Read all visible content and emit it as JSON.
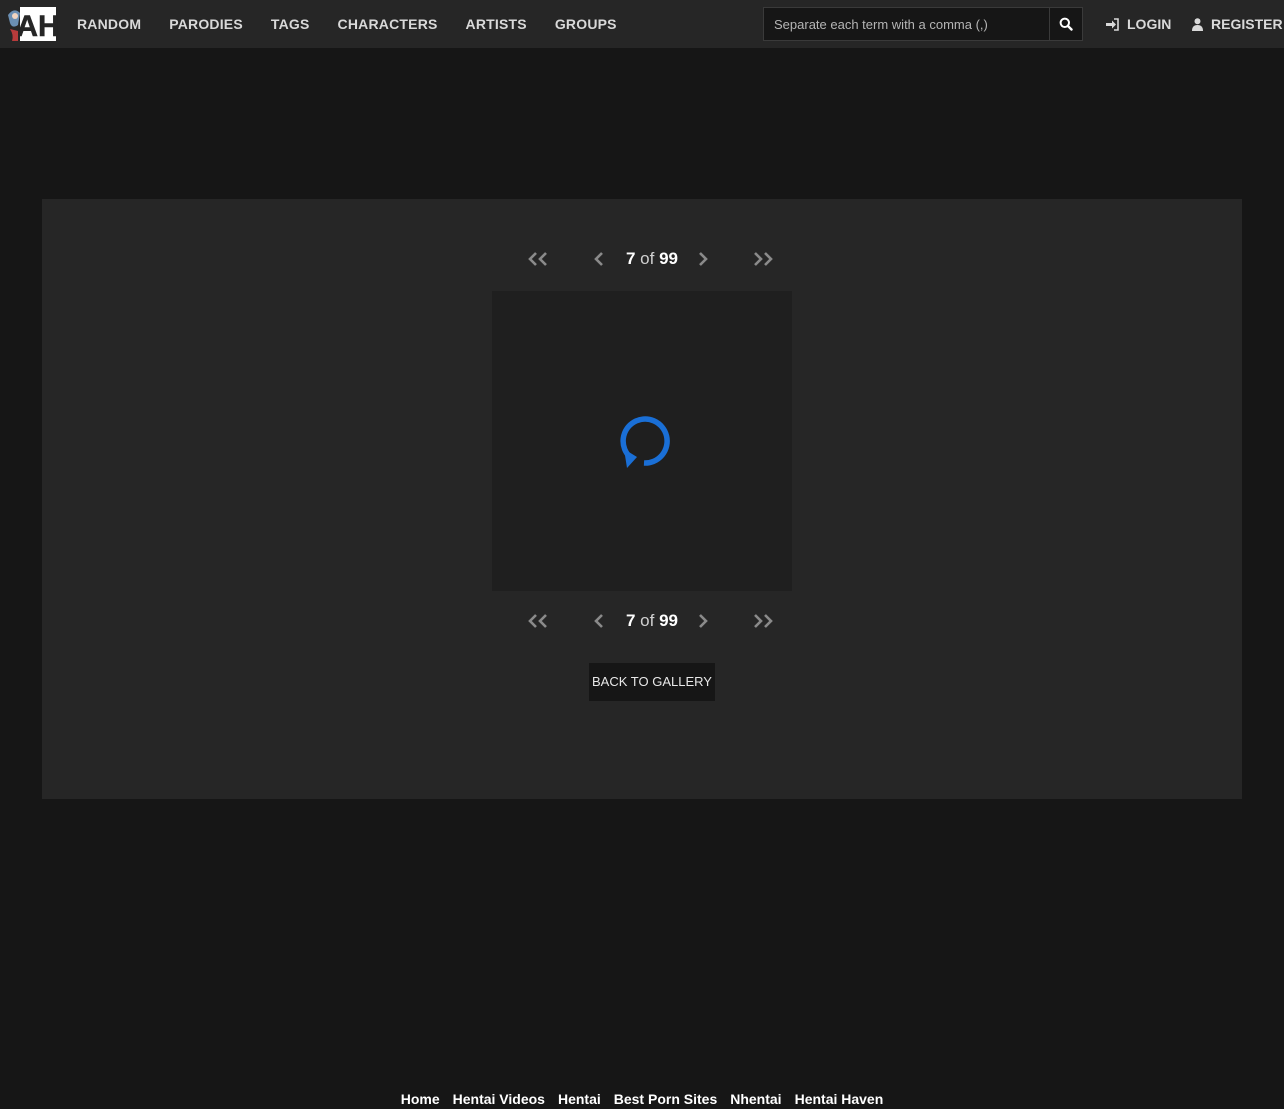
{
  "nav": {
    "logo_text": "AH",
    "links": [
      "RANDOM",
      "PARODIES",
      "TAGS",
      "CHARACTERS",
      "ARTISTS",
      "GROUPS"
    ],
    "search_placeholder": "Separate each term with a comma (,)",
    "login_label": "LOGIN",
    "register_label": "REGISTER"
  },
  "viewer": {
    "current_page": "7",
    "of_label": "of",
    "total_pages": "99",
    "back_label": "BACK TO GALLERY"
  },
  "footer": {
    "links": [
      "Home",
      "Hentai Videos",
      "Hentai",
      "Best Porn Sites",
      "Nhentai",
      "Hentai Haven"
    ]
  },
  "colors": {
    "background": "#161616",
    "panel": "#262626",
    "spinner": "#1a6fd6"
  }
}
